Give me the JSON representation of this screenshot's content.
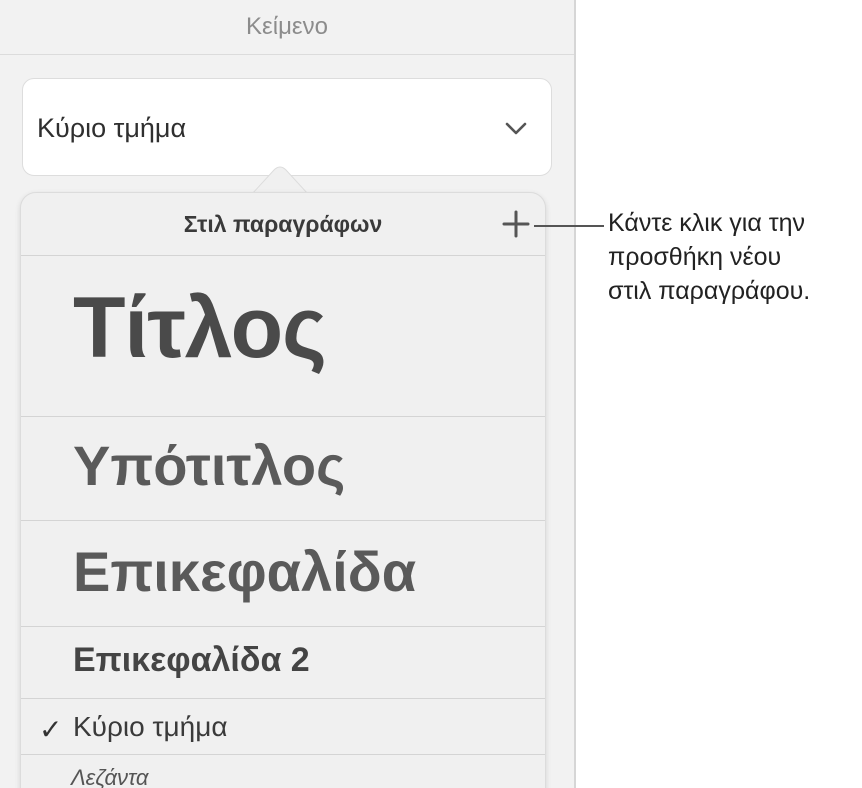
{
  "panel": {
    "title": "Κείμενο"
  },
  "style_select": {
    "value": "Κύριο τμήμα"
  },
  "popover": {
    "title": "Στιλ παραγράφων",
    "items": [
      {
        "label": "Τίτλος",
        "selected": false
      },
      {
        "label": "Υπότιτλος",
        "selected": false
      },
      {
        "label": "Επικεφαλίδα",
        "selected": false
      },
      {
        "label": "Επικεφαλίδα 2",
        "selected": false
      },
      {
        "label": "Κύριο τμήμα",
        "selected": true,
        "check": "✓"
      },
      {
        "label": "Λεζάντα",
        "selected": false
      }
    ]
  },
  "callout": {
    "line1": "Κάντε κλικ για την",
    "line2": "προσθήκη νέου",
    "line3": "στιλ παραγράφου."
  },
  "icons": {
    "dropdown": "chevron-down-icon",
    "add": "plus-icon",
    "selected": "checkmark-icon"
  }
}
